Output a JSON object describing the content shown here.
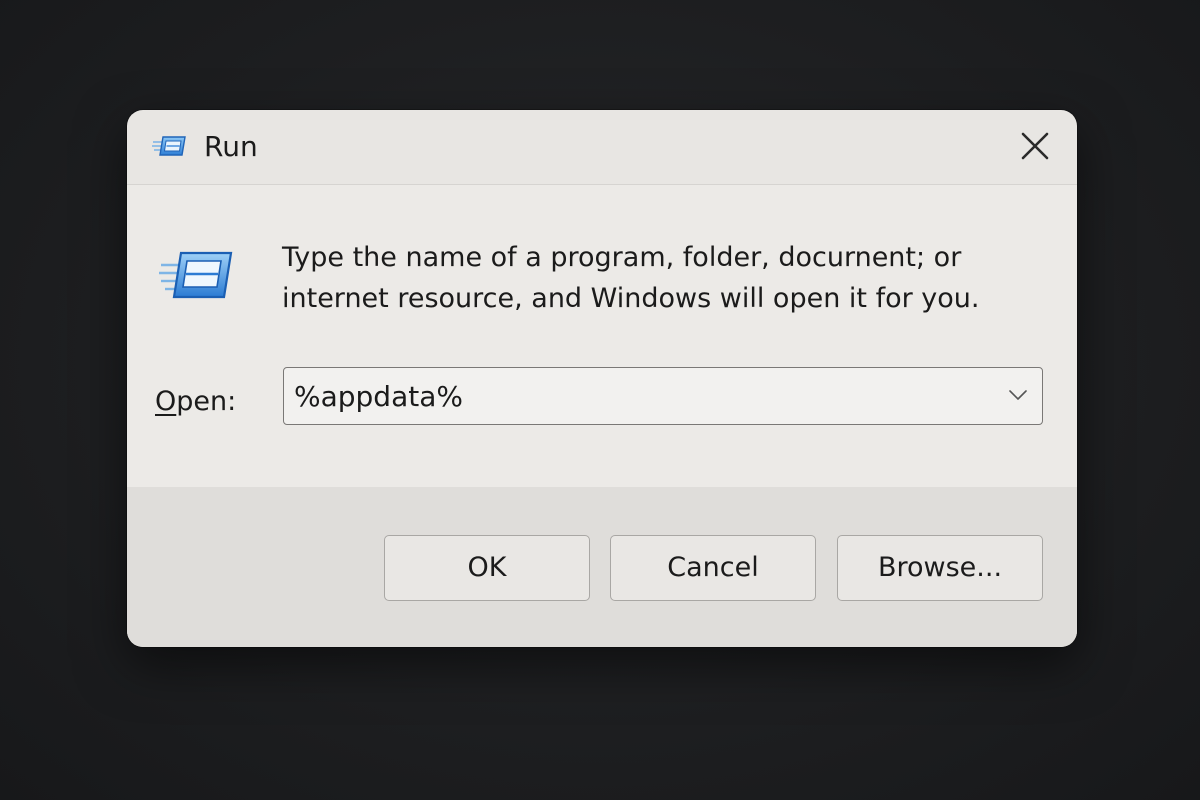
{
  "window": {
    "title": "Run",
    "title_icon": "run-icon",
    "close_icon": "close-icon"
  },
  "content": {
    "message_line1": "Type the name of a program, folder, docurnent; or",
    "message_line2": "internet resource, and Windows will open it for you.",
    "open_label_accel": "O",
    "open_label_rest": "pen:",
    "open_value": "%appdata%",
    "dropdown_icon": "chevron-down-icon"
  },
  "buttons": {
    "ok": "OK",
    "cancel": "Cancel",
    "browse": "Browse..."
  },
  "colors": {
    "dialog_bg": "#e8e6e3",
    "footer_bg": "#dfddda",
    "icon_blue": "#3c8fe0",
    "backdrop": "#1d1e20"
  }
}
